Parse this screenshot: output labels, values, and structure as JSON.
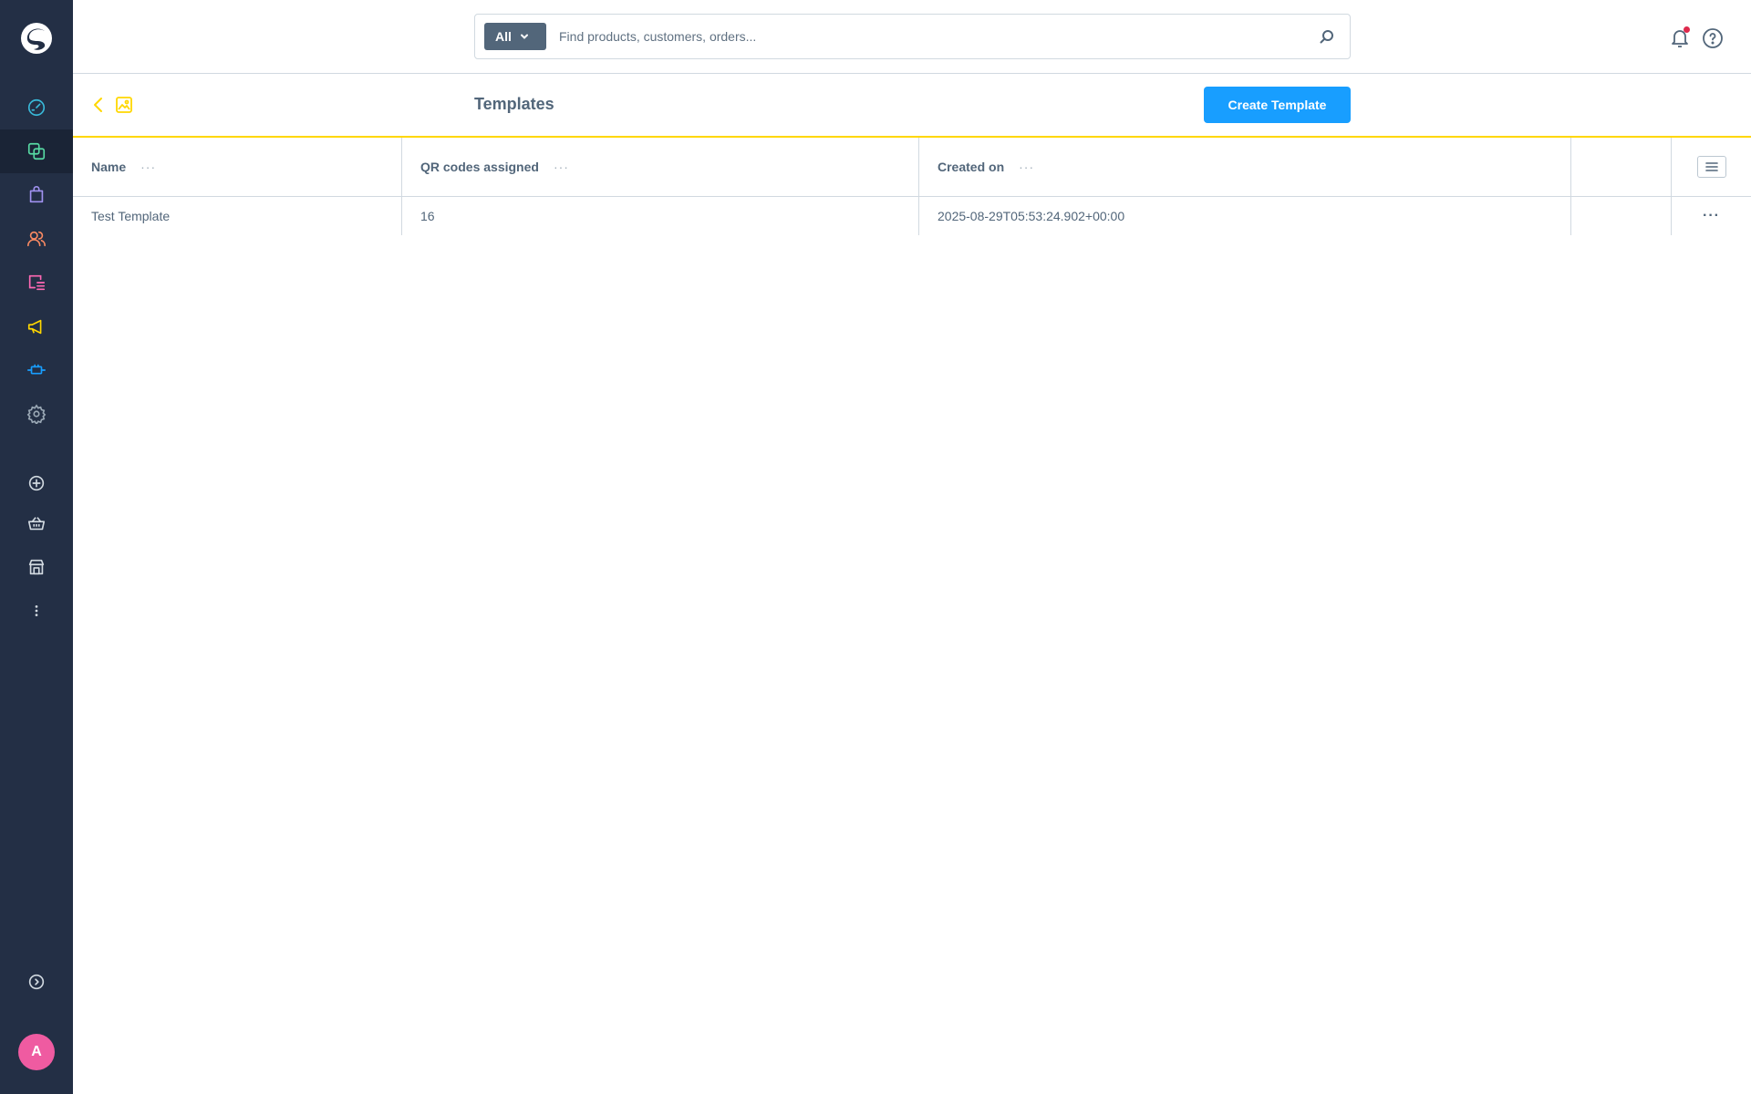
{
  "colors": {
    "sidebar_bg": "#232f45",
    "accent": "#189eff",
    "smartbar_border": "#ffd700",
    "avatar": "#ef5ba1"
  },
  "sidebar": {
    "items": [
      {
        "icon": "dashboard-icon",
        "color": "#39b9d9"
      },
      {
        "icon": "catalogues-icon",
        "color": "#57d9a3",
        "active": true
      },
      {
        "icon": "orders-icon",
        "color": "#a092f0"
      },
      {
        "icon": "customers-icon",
        "color": "#f88962"
      },
      {
        "icon": "content-icon",
        "color": "#ff68b4"
      },
      {
        "icon": "marketing-icon",
        "color": "#ffd700"
      },
      {
        "icon": "extensions-icon",
        "color": "#189eff"
      },
      {
        "icon": "settings-icon",
        "color": "#9aa8b5"
      },
      {
        "icon": "add-sales-channel-icon",
        "color": "#d1d9e0"
      },
      {
        "icon": "storefront-basket-icon",
        "color": "#d1d9e0"
      },
      {
        "icon": "store-icon",
        "color": "#d1d9e0"
      },
      {
        "icon": "more-icon",
        "color": "#d1d9e0"
      },
      {
        "icon": "collapse-menu-icon",
        "color": "#d1d9e0"
      }
    ],
    "avatar_initial": "A"
  },
  "topbar": {
    "search_type": "All",
    "search_placeholder": "Find products, customers, orders..."
  },
  "smartbar": {
    "title": "Templates",
    "create_button": "Create Template"
  },
  "grid": {
    "columns": [
      "Name",
      "QR codes assigned",
      "Created on"
    ],
    "rows": [
      {
        "name": "Test Template",
        "qr_codes": "16",
        "created_on": "2025-08-29T05:53:24.902+00:00"
      }
    ]
  }
}
